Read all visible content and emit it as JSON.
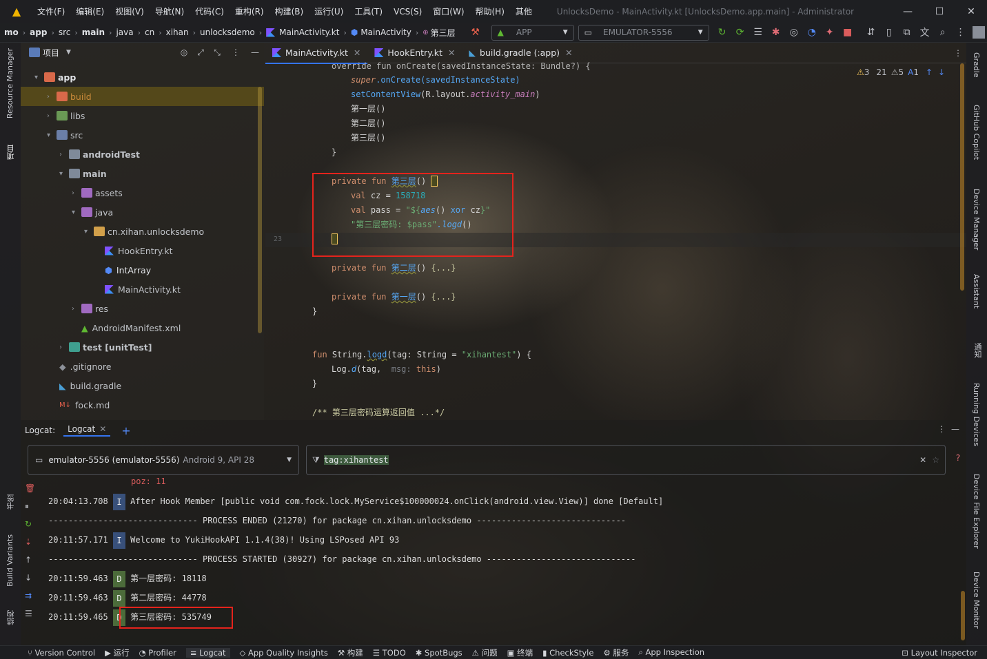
{
  "menubar": {
    "items": [
      "文件(F)",
      "编辑(E)",
      "视图(V)",
      "导航(N)",
      "代码(C)",
      "重构(R)",
      "构建(B)",
      "运行(U)",
      "工具(T)",
      "VCS(S)",
      "窗口(W)",
      "帮助(H)",
      "其他"
    ],
    "window_title": "UnlocksDemo - MainActivity.kt [UnlocksDemo.app.main] - Administrator"
  },
  "breadcrumb": {
    "items": [
      "mo",
      "app",
      "src",
      "main",
      "java",
      "cn",
      "xihan",
      "unlocksdemo",
      "MainActivity.kt",
      "MainActivity",
      "第三层"
    ]
  },
  "toolbar": {
    "run_config": "APP",
    "device": "EMULATOR-5556"
  },
  "project_panel": {
    "title": "项目",
    "items": [
      {
        "label": "app"
      },
      {
        "label": "build"
      },
      {
        "label": "libs"
      },
      {
        "label": "src"
      },
      {
        "label": "androidTest"
      },
      {
        "label": "main"
      },
      {
        "label": "assets"
      },
      {
        "label": "java"
      },
      {
        "label": "cn.xihan.unlocksdemo"
      },
      {
        "label": "HookEntry.kt"
      },
      {
        "label": "IntArray"
      },
      {
        "label": "MainActivity.kt"
      },
      {
        "label": "res"
      },
      {
        "label": "AndroidManifest.xml"
      },
      {
        "label": "test [unitTest]"
      },
      {
        "label": ".gitignore"
      },
      {
        "label": "build.gradle"
      },
      {
        "label": "fock.md"
      }
    ]
  },
  "editor": {
    "tabs": [
      {
        "label": "MainActivity.kt"
      },
      {
        "label": "HookEntry.kt"
      },
      {
        "label": "build.gradle (:app)"
      }
    ],
    "inspections": {
      "warnings": "3",
      "weak": "21",
      "typos": "5",
      "other": "1"
    },
    "line_number": "23",
    "code": {
      "l1": "override fun onCreate(savedInstanceState: Bundle?) {",
      "super_kw": "super",
      "oncreate_call": ".onCreate(savedInstanceState)",
      "setcontent_fn": "setContentView",
      "setcontent_arg1": "(R.layout.",
      "setcontent_arg2": "activity_main",
      "setcontent_arg3": ")",
      "call1": "第一层()",
      "call2": "第二层()",
      "call3": "第三层()",
      "close1": "}",
      "private_kw": "private fun ",
      "fun3_name": "第三层",
      "parens": "()",
      "val_kw": "val ",
      "cz_name": "cz",
      "cz_eq": " = ",
      "cz_value": "158718",
      "pass_name": "pass",
      "pass_eq": " = ",
      "pass_str_open": "\"${",
      "aes_call": "aes",
      "aes_parens": "() ",
      "xor_kw": "xor",
      " cz_ref": " cz",
      "pass_str_close": "}\"",
      "log_str": "\"第三层密码: $pass\"",
      "logd_call": ".logd",
      "logd_parens": "()",
      "fun2_name": "第二层",
      "fun1_name": "第一层",
      "folded": " {...}",
      "close2": "}",
      "ext_fun": "fun ",
      "ext_type": "String.",
      "ext_name": "logd",
      "ext_params1": "(tag: ",
      "ext_type2": "String",
      " ext_eq": " = ",
      "ext_tag": "\"xihantest\"",
      "ext_params2": ") {",
      "log_obj": "Log.",
      "log_fn": "d",
      "log_args1": "(tag,  ",
      "log_msg_hint": "msg:",
      " log_this": " this",
      "log_args2": ")",
      "close3": "}",
      "comment": "/** 第三层密码运算返回值 ...*/"
    }
  },
  "logcat": {
    "label": "Logcat:",
    "tab": "Logcat",
    "device": "emulator-5556 (emulator-5556)",
    "device_api": "Android 9, API 28",
    "filter": "tag:xihantest",
    "truncated": "poz: 11",
    "rows": [
      {
        "time": "20:04:13.708",
        "level": "I",
        "msg": "After Hook Member [public void com.fock.lock.MyService$100000024.onClick(android.view.View)] done [Default]"
      },
      {
        "msg": "------------------------------ PROCESS ENDED (21270) for package cn.xihan.unlocksdemo ------------------------------"
      },
      {
        "time": "20:11:57.171",
        "level": "I",
        "msg": "Welcome to YukiHookAPI 1.1.4(38)! Using LSPosed API 93"
      },
      {
        "msg": "------------------------------ PROCESS STARTED (30927) for package cn.xihan.unlocksdemo ------------------------------"
      },
      {
        "time": "20:11:59.463",
        "level": "D",
        "msg": "第一层密码: 18118"
      },
      {
        "time": "20:11:59.463",
        "level": "D",
        "msg": "第二层密码: 44778"
      },
      {
        "time": "20:11:59.465",
        "level": "D",
        "msg": "第三层密码: 535749"
      }
    ]
  },
  "left_stripe": {
    "resource_manager": "Resource Manager",
    "project": "项目",
    "bookmarks": "书签",
    "build_variants": "Build Variants",
    "structure": "结构"
  },
  "right_stripe": [
    "Gradle",
    "GitHub Copilot",
    "Device Manager",
    "Assistant",
    "通知",
    "Running Devices",
    "Device File Explorer",
    "Device Monitor"
  ],
  "statusbar": {
    "items": [
      "Version Control",
      "运行",
      "Profiler",
      "Logcat",
      "App Quality Insights",
      "构建",
      "TODO",
      "SpotBugs",
      "问题",
      "终端",
      "CheckStyle",
      "服务",
      "App Inspection"
    ],
    "right": "Layout Inspector"
  },
  "colors": {
    "accent": "#3574f0",
    "highlight_box": "#e5231c",
    "kotlin_keyword": "#cf8e6d",
    "function": "#56a8f5",
    "string": "#6aab73",
    "number": "#2aacb8"
  }
}
